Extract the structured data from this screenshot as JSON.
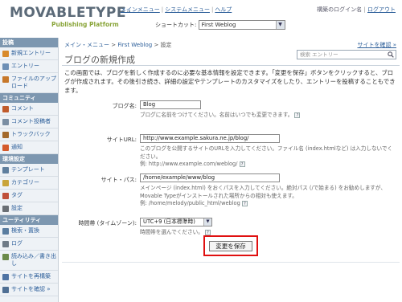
{
  "header": {
    "logo_word": "MOVABLETYPE",
    "logo_tm": "™",
    "logo_sub": "Publishing Platform",
    "nav": [
      "メインメニュー",
      "システムメニュー",
      "ヘルプ"
    ],
    "user_text": "構築のログイン名",
    "logout": "ログアウト",
    "shortcut_label": "ショートカット:",
    "shortcut_value": "First Weblog"
  },
  "sidebar": {
    "sections": [
      {
        "title": "投稿",
        "items": [
          {
            "label": "新規エントリー",
            "icon": "new-entry-icon",
            "color": "#d88a2b"
          },
          {
            "label": "エントリー",
            "icon": "entries-icon",
            "color": "#6d8fb5"
          },
          {
            "label": "ファイルのアップロード",
            "icon": "upload-icon",
            "color": "#c7782a"
          }
        ]
      },
      {
        "title": "コミュニティ",
        "items": [
          {
            "label": "コメント",
            "icon": "comment-icon",
            "color": "#c05b2b"
          },
          {
            "label": "コメント投稿者",
            "icon": "commenters-icon",
            "color": "#7a8ea3"
          },
          {
            "label": "トラックバック",
            "icon": "trackback-icon",
            "color": "#a46a2c"
          },
          {
            "label": "通知",
            "icon": "notification-icon",
            "color": "#d45a2b"
          }
        ]
      },
      {
        "title": "環境設定",
        "items": [
          {
            "label": "テンプレート",
            "icon": "template-icon",
            "color": "#5f7f9e"
          },
          {
            "label": "カテゴリー",
            "icon": "category-icon",
            "color": "#c9a43a"
          },
          {
            "label": "タグ",
            "icon": "tag-icon",
            "color": "#c0503a"
          },
          {
            "label": "設定",
            "icon": "settings-icon",
            "color": "#6a6f75"
          }
        ]
      },
      {
        "title": "ユーティリティ",
        "items": [
          {
            "label": "検索・置換",
            "icon": "search-icon",
            "color": "#5a7da0"
          },
          {
            "label": "ログ",
            "icon": "log-icon",
            "color": "#6e7a86"
          },
          {
            "label": "読み込み／書き出し",
            "icon": "import-export-icon",
            "color": "#6a8a4a"
          },
          {
            "label": "サイトを再構築",
            "icon": "rebuild-icon",
            "color": "#4e73a3"
          },
          {
            "label": "サイトを確認 »",
            "icon": "view-site-icon",
            "color": "#4f6f94"
          }
        ]
      }
    ]
  },
  "main": {
    "breadcrumb": [
      "メイン・メニュー",
      "First Weblog",
      "設定"
    ],
    "view_site": "サイトを確認 »",
    "title": "ブログの新規作成",
    "search_placeholder": "検索 エントリー",
    "intro": "この画面では、ブログを新しく作成するのに必要な基本情報を設定できます。「変更を保存」ボタンをクリックすると、ブログが作成されます。その後引き続き、詳細の設定やテンプレートのカスタマイズをしたり、エントリーを投稿することもできます。",
    "fields": {
      "blog_name": {
        "label": "ブログ名:",
        "value": "Blog",
        "hint": "ブログに名前をつけてください。名前はいつでも変更できます。"
      },
      "site_url": {
        "label": "サイトURL:",
        "value": "http://www.example.sakura.ne.jp/blog/",
        "hint1": "このブログを公開するサイトのURLを入力してください。ファイル名 (index.htmlなど) は入力しないでください。",
        "hint2": "例: http://www.example.com/weblog/"
      },
      "site_path": {
        "label": "サイト・パス:",
        "value": "/home/example/www/blog",
        "hint1": "メインページ (index.html) をおくパスを入力してください。絶対パス (/で始まる) をお勧めしますが、Movable Typeがインストールされた場所からの相対も使えます。",
        "hint2": "例: /home/melody/public_html/weblog"
      },
      "timezone": {
        "label": "時間帯 (タイムゾーン):",
        "value": "UTC+9 (日本標準時)",
        "hint": "時間帯を選んでください。"
      }
    },
    "save_label": "変更を保存",
    "help_mark": "?"
  },
  "colors": {
    "accent": "#e01010",
    "sidebar_header": "#7d97b0",
    "link": "#2d5f9a"
  }
}
